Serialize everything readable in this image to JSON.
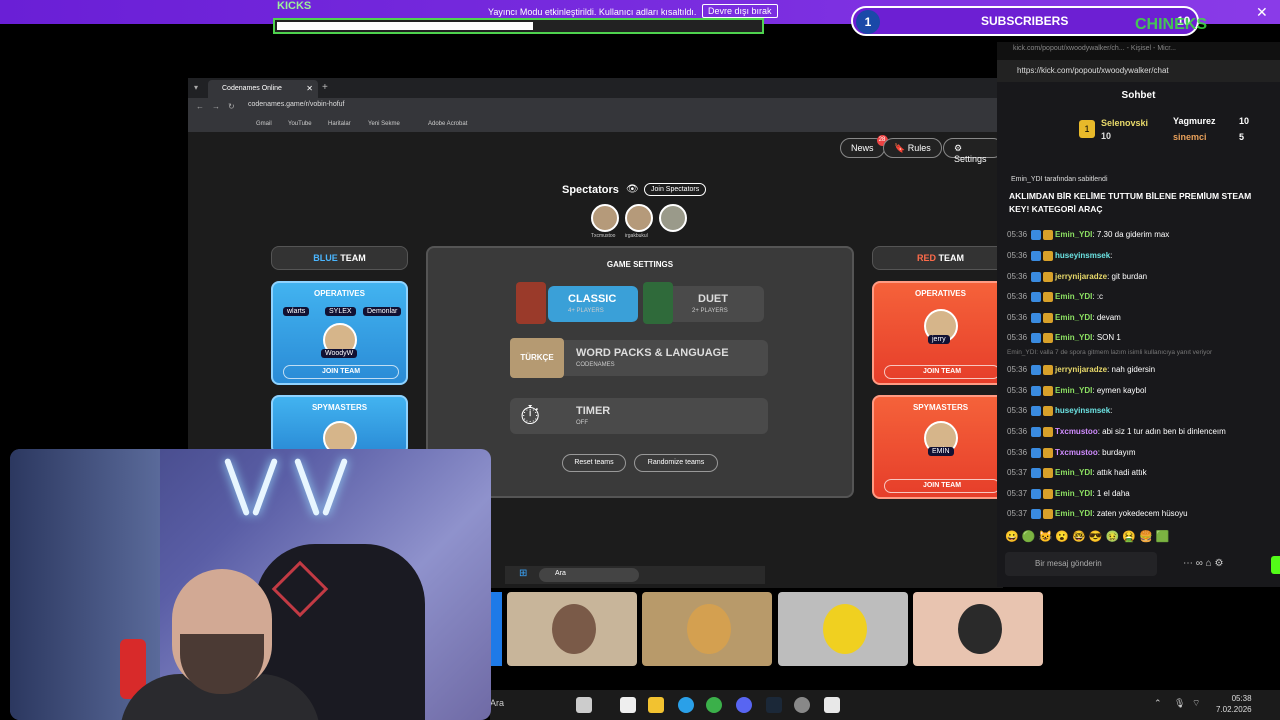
{
  "overlay": {
    "kicks_label": "KICKS",
    "progress_fraction": 0.53,
    "notice_text": "Yayıncı Modu etkinleştirildi. Kullanıcı adları kısaltıldı.",
    "notice_button": "Devre dışı bırak",
    "subscribers": {
      "current": "1",
      "title": "SUBSCRIBERS",
      "goal": "10"
    },
    "close": "✕",
    "watermark": "CHINEKS"
  },
  "browser": {
    "tab_title": "Codenames Online",
    "url": "codenames.game/r/vobin-hofuf",
    "bookmarks": [
      "Gmail",
      "YouTube",
      "Haritalar",
      "Yeni Sekme",
      "Adobe Acrobat"
    ],
    "top_buttons": {
      "news": "News",
      "news_count": "28",
      "rules": "Rules",
      "settings": "Settings"
    },
    "spectators": {
      "title": "Spectators",
      "join_label": "Join Spectators",
      "names": [
        "Txcmustoo",
        "irgakbukul",
        ""
      ]
    },
    "blue_team": {
      "header_colored": "BLUE",
      "header_rest": " TEAM",
      "operatives_title": "OPERATIVES",
      "operatives": [
        "wlarts",
        "SYLEX",
        "Demonlar"
      ],
      "operative_center": "WoodyW",
      "join_label": "JOIN TEAM",
      "spymasters_title": "SPYMASTERS"
    },
    "red_team": {
      "header_colored": "RED",
      "header_rest": " TEAM",
      "operatives_title": "OPERATIVES",
      "operative": "jerry",
      "join_label": "JOIN TEAM",
      "spymasters_title": "SPYMASTERS",
      "spymaster": "EMİN",
      "join_label2": "JOIN TEAM"
    },
    "game_settings": {
      "title": "GAME SETTINGS",
      "classic": "CLASSIC",
      "classic_sub": "4+ PLAYERS",
      "duet": "DUET",
      "duet_sub": "2+ PLAYERS",
      "word_packs": "WORD PACKS & LANGUAGE",
      "word_packs_sub": "CODENAMES",
      "language_tag": "TÜRKÇE",
      "timer": "TIMER",
      "timer_sub": "OFF",
      "reset": "Reset teams",
      "randomize": "Randomize teams"
    },
    "taskbar_search": "Ara"
  },
  "taskbar": {
    "search": "Ara",
    "time": "05:38",
    "date": "7.02.2026"
  },
  "chat": {
    "window_title": "kick.com/popout/xwoodywalker/ch... - Kişisel - Micr...",
    "url": "https://kick.com/popout/xwoodywalker/chat",
    "title": "Sohbet",
    "leaders": [
      {
        "name": "Selenovski",
        "count": "10"
      },
      {
        "name": "Yagmurez",
        "count": "10"
      },
      {
        "name": "sinemci",
        "count": "5"
      }
    ],
    "pinned_by": "Emin_YDI tarafından sabitlendi",
    "pinned_message": "AKLIMDAN BİR KELİME TUTTUM BİLENE PREMİUM STEAM KEY! KATEGORİ ARAÇ",
    "messages": [
      {
        "time": "05:36",
        "user": "Emin_YDI",
        "text": "7.30 da giderim max"
      },
      {
        "time": "05:36",
        "user": "huseyinsmsek",
        "text": ""
      },
      {
        "time": "05:36",
        "user": "jerrynijaradze",
        "text": "git burdan"
      },
      {
        "time": "05:36",
        "user": "Emin_YDI",
        "text": ":c"
      },
      {
        "time": "05:36",
        "user": "Emin_YDI",
        "text": "devam"
      },
      {
        "time": "05:36",
        "user": "Emin_YDI",
        "text": "SON 1"
      },
      {
        "time": "05:36",
        "user": "jerrynijaradze",
        "text": "nah gidersin"
      },
      {
        "time": "05:36",
        "user": "Emin_YDI",
        "text": "eymen kaybol"
      },
      {
        "time": "05:36",
        "user": "huseyinsmsek",
        "text": ""
      },
      {
        "time": "05:36",
        "user": "Txcmustoo",
        "text": "abi siz 1 tur adın ben bi dinlenceım"
      },
      {
        "time": "05:36",
        "user": "Txcmustoo",
        "text": "burdayım"
      },
      {
        "time": "05:37",
        "user": "Emin_YDI",
        "text": "attık hadi attık"
      },
      {
        "time": "05:37",
        "user": "Emin_YDI",
        "text": "1 el daha"
      },
      {
        "time": "05:37",
        "user": "Emin_YDI",
        "text": "zaten yokedecem hüsoyu"
      }
    ],
    "reply_preview": "Emin_YDI: valla 7 de spora gitmem lazım isimli kullanıcıya yanıt veriyor",
    "input_placeholder": "Bir mesaj gönderin",
    "emotes": "😀 🟢 😺 😮 🤓 😎 🤢 🤮 🍔 🟩"
  },
  "colors": {
    "overlay_purple": "#6a1fd6",
    "kick_green": "#53fc18",
    "blue_team": "#42b3f0",
    "red_team": "#f5623a"
  }
}
